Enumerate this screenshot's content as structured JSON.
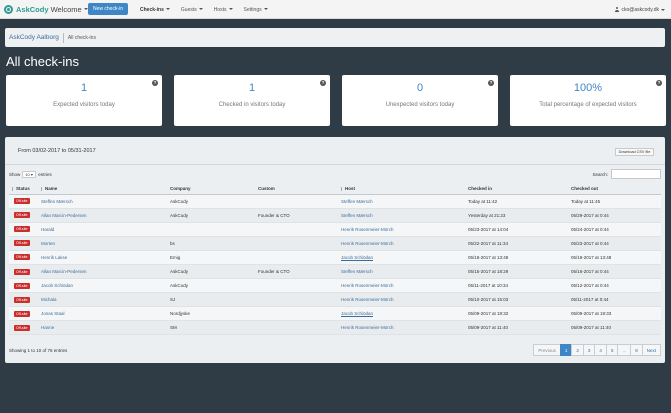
{
  "app": {
    "brand_prefix": "AskCody",
    "brand_suffix": "Welcome",
    "new_checkin": "New check-in",
    "nav": [
      "Check-ins",
      "Guests",
      "Hosts",
      "Settings"
    ],
    "user_email": "cko@askcody.dk"
  },
  "breadcrumb": {
    "home": "AskCody Aalborg",
    "current": "All check-ins"
  },
  "page_title": "All check-ins",
  "stats": [
    {
      "value": "1",
      "label": "Expected visitors today"
    },
    {
      "value": "1",
      "label": "Checked in visitors today"
    },
    {
      "value": "0",
      "label": "Unexpected visitors today"
    },
    {
      "value": "100%",
      "label": "Total percentage of expected visitors"
    }
  ],
  "panel": {
    "range": "From 03/02-2017 to 05/31-2017",
    "download": "Download CSV file",
    "show_label": "Show",
    "show_value": "10",
    "entries_label": "entries",
    "search_label": "Search:",
    "info": "Showing 1 to 10 of 76 entries"
  },
  "columns": [
    "Status",
    "Name",
    "Company",
    "Custom",
    "Host",
    "Checked in",
    "Checked out"
  ],
  "rows": [
    {
      "status": "Off-site",
      "name": "Steffen Mærsch",
      "company": "AskCody",
      "custom": "",
      "host": "Steffen Mærsch",
      "in": "Today at 11:42",
      "out": "Today at 11:45"
    },
    {
      "status": "Off-site",
      "name": "Allan Marcin-Pedersen",
      "company": "AskCody",
      "custom": "Founder & CTO",
      "host": "Steffen Mærsch",
      "in": "Yesterday at 21:23",
      "out": "05/29-2017 at 0:44"
    },
    {
      "status": "Off-site",
      "name": "Harald",
      "company": "",
      "custom": "",
      "host": "Henrik Rosenmeier-Mörch",
      "in": "05/23-2017 at 14:04",
      "out": "05/24-2017 at 0:44"
    },
    {
      "status": "Off-site",
      "name": "Morten",
      "company": "bs",
      "custom": "",
      "host": "Henrik Rosenmeier-Mörch",
      "in": "05/22-2017 at 11:34",
      "out": "05/23-2017 at 0:44"
    },
    {
      "status": "Off-site",
      "name": "Henrik Lakse",
      "company": "Emig",
      "custom": "",
      "host": "Jacob Schiödan",
      "in": "05/18-2017 at 13:48",
      "out": "05/18-2017 at 13:48"
    },
    {
      "status": "Off-site",
      "name": "Allan Marcin-Pedersen",
      "company": "AskCody",
      "custom": "Founder & CTO",
      "host": "Steffen Mærsch",
      "in": "05/15-2017 at 18:29",
      "out": "05/16-2017 at 0:44"
    },
    {
      "status": "Off-site",
      "name": "Jacob Schiödan",
      "company": "AskCody",
      "custom": "",
      "host": "Henrik Rosenmeier-Mörch",
      "in": "05/11-2017 at 10:34",
      "out": "05/12-2017 at 0:44"
    },
    {
      "status": "Off-site",
      "name": "Michala",
      "company": "SJ",
      "custom": "",
      "host": "Henrik Rosenmeier-Mörch",
      "in": "05/10-2017 at 15:03",
      "out": "05/11-2017 at 0:44"
    },
    {
      "status": "Off-site",
      "name": "Jonas Staal",
      "company": "Nordjyske",
      "custom": "",
      "host": "Jacob Schiödan",
      "in": "05/09-2017 at 19:32",
      "out": "05/09-2017 at 19:33"
    },
    {
      "status": "Off-site",
      "name": "Hanne",
      "company": "SM",
      "custom": "",
      "host": "Henrik Rosenmeier-Mörch",
      "in": "05/09-2017 at 11:40",
      "out": "05/09-2017 at 11:40"
    }
  ],
  "pager": {
    "prev": "Previous",
    "pages": [
      "1",
      "2",
      "3",
      "4",
      "5",
      "...",
      "8"
    ],
    "next": "Next",
    "current": "1"
  }
}
